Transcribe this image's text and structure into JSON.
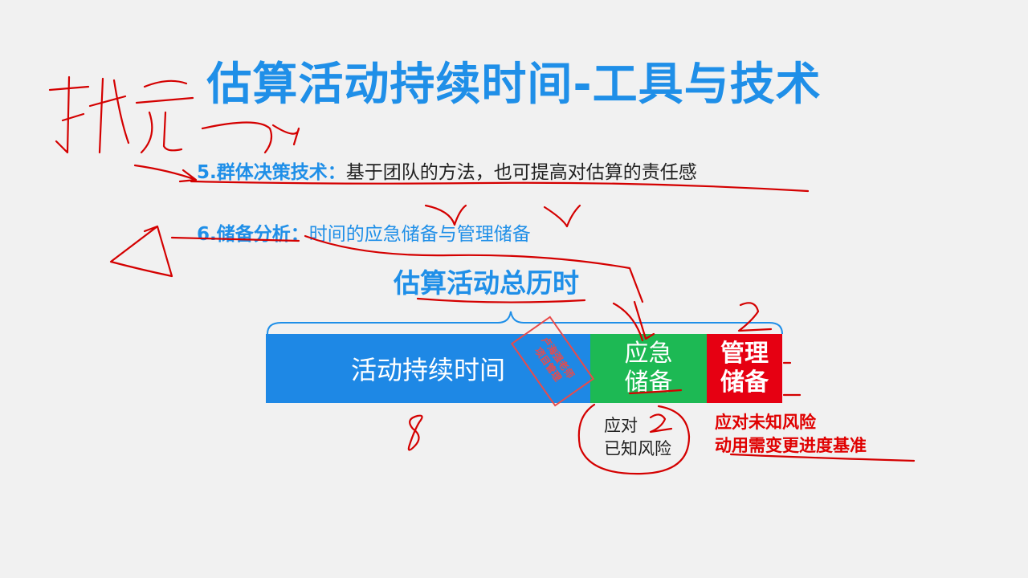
{
  "title": "估算活动持续时间-工具与技术",
  "items": [
    {
      "label": "5.群体决策技术：",
      "text": "基于团队的方法，也可提高对估算的责任感"
    },
    {
      "label": "6.储备分析：",
      "text": "时间的应急储备与管理储备"
    }
  ],
  "diagram": {
    "total_label": "估算活动总历时",
    "segments": {
      "activity": "活动持续时间",
      "contingency": [
        "应急",
        "储备"
      ],
      "management": [
        "管理",
        "储备"
      ]
    },
    "contingency_note": [
      "应对",
      "已知风险"
    ],
    "management_note": [
      "应对未知风险",
      "动用需变更进度基准"
    ]
  },
  "stamp": [
    "卢海强老师",
    "项目管理"
  ],
  "colors": {
    "accent": "#1f8fe8",
    "activity": "#1e88e5",
    "contingency": "#1db954",
    "management": "#e60012",
    "ink": "#d40000"
  }
}
